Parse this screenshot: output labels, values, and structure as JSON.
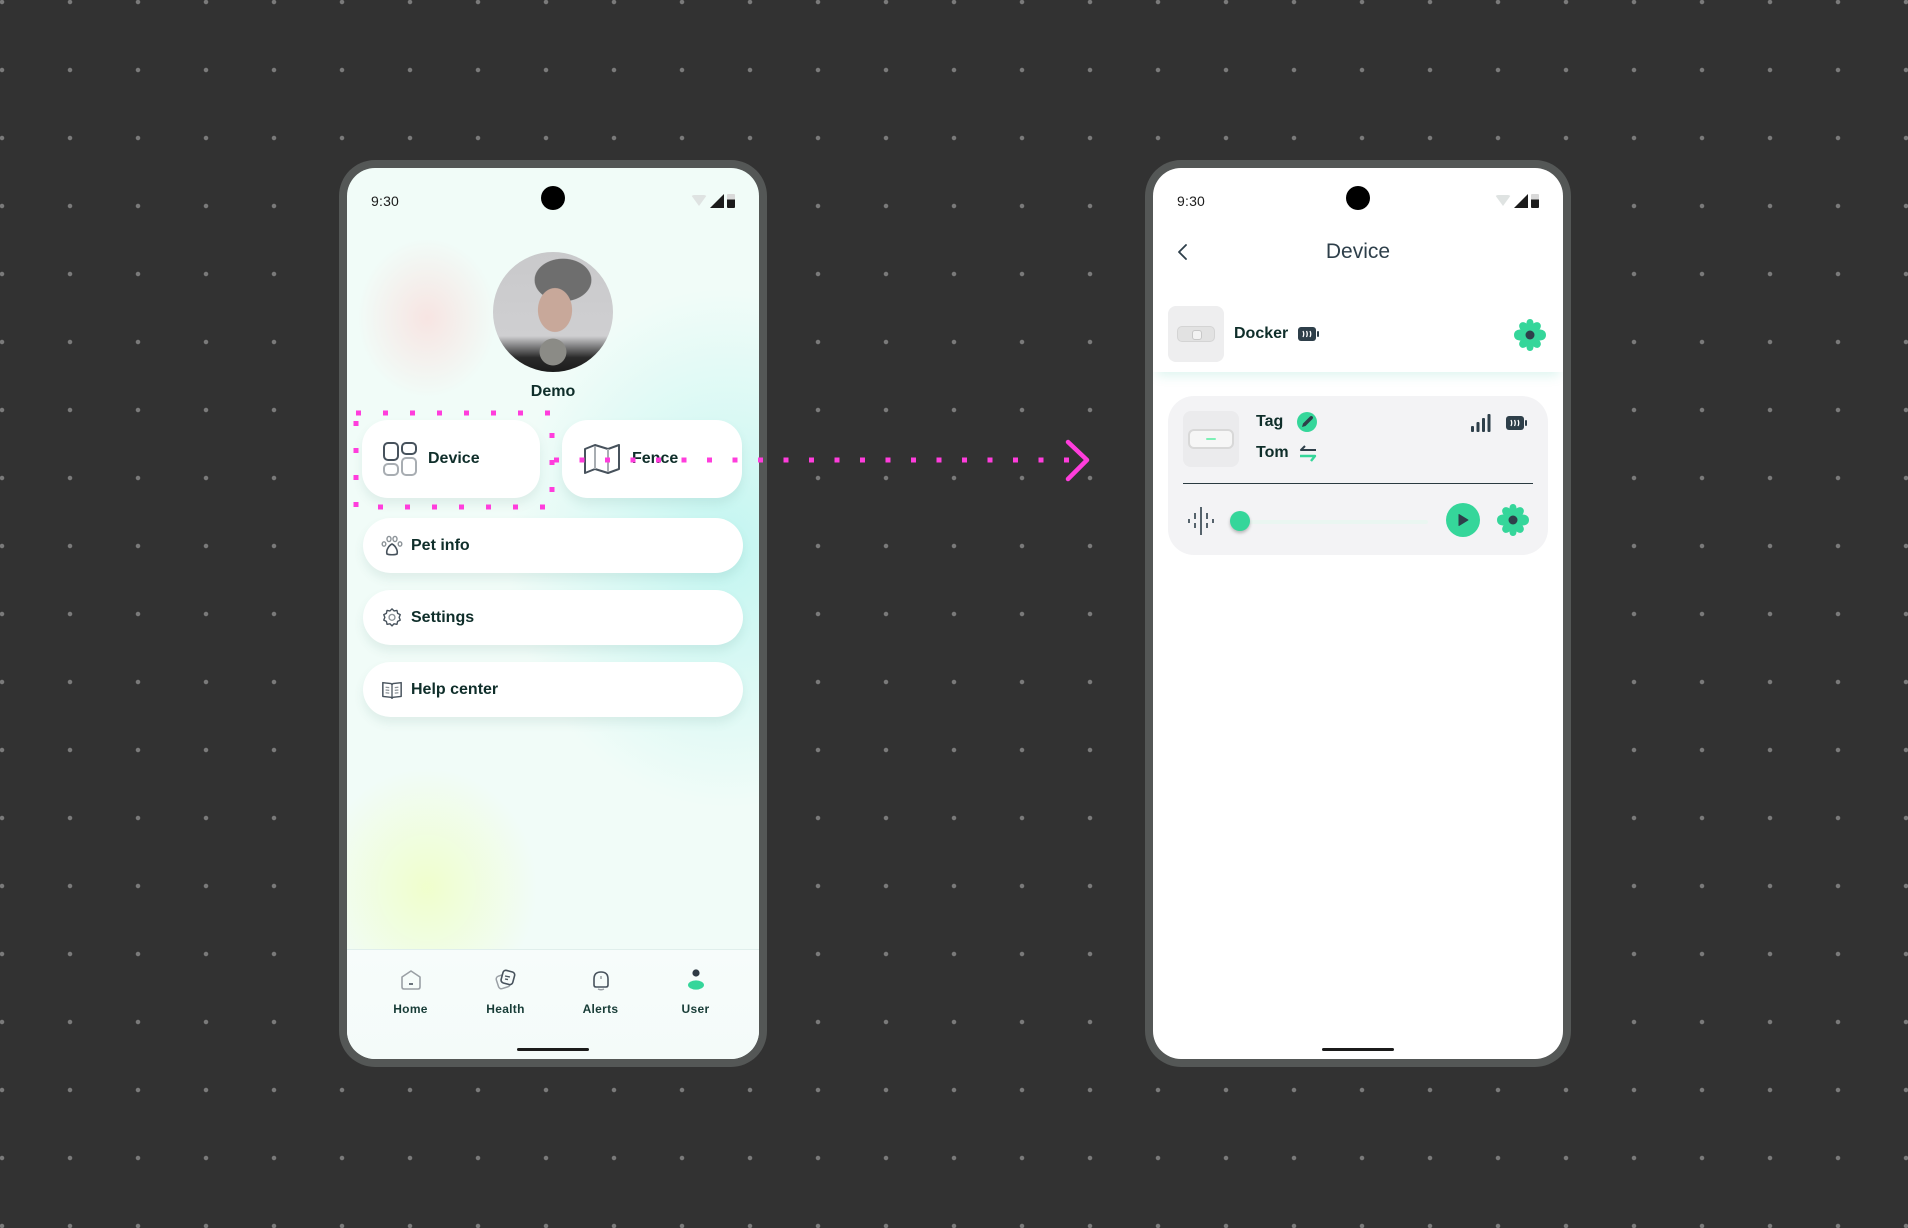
{
  "accent_color": "#35d69a",
  "annotation_color": "#ff3ddc",
  "left_phone": {
    "status_bar": {
      "time": "9:30"
    },
    "profile": {
      "name": "Demo",
      "avatar": "avatar-photo"
    },
    "tiles": [
      {
        "label": "Device",
        "icon": "device-grid-icon",
        "highlighted": true
      },
      {
        "label": "Fence",
        "icon": "map-icon",
        "highlighted": false
      }
    ],
    "menu": [
      {
        "label": "Pet info",
        "icon": "paw-icon"
      },
      {
        "label": "Settings",
        "icon": "gear-icon"
      },
      {
        "label": "Help center",
        "icon": "book-icon"
      }
    ],
    "bottom_nav": [
      {
        "label": "Home",
        "icon": "home-icon",
        "active": false
      },
      {
        "label": "Health",
        "icon": "health-icon",
        "active": false
      },
      {
        "label": "Alerts",
        "icon": "bell-icon",
        "active": false
      },
      {
        "label": "User",
        "icon": "user-icon",
        "active": true
      }
    ]
  },
  "transition": {
    "from": "Device",
    "to": "Device screen"
  },
  "right_phone": {
    "status_bar": {
      "time": "9:30"
    },
    "header": {
      "title": "Device",
      "back_icon": "chevron-left-icon"
    },
    "docker": {
      "name": "Docker",
      "battery_icon": "battery-icon",
      "settings_icon": "gear-icon"
    },
    "tag": {
      "name": "Tag",
      "pet": "Tom",
      "edit_icon": "pencil-icon",
      "swap_icon": "swap-icon",
      "signal_icon": "signal-bars-icon",
      "battery_icon": "battery-icon",
      "audio_icon": "sound-wave-icon",
      "play_icon": "play-icon",
      "settings_icon": "gear-icon",
      "slider_progress": 0
    }
  }
}
